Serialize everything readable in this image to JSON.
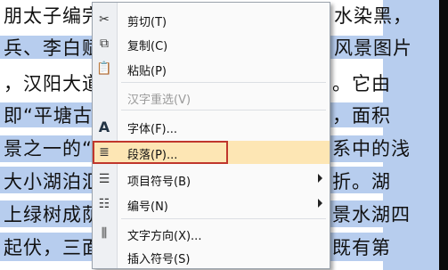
{
  "document": {
    "lines_left": [
      "朋太子编完",
      "兵、李白赋诗",
      "，汉阳大道以",
      "即“平塘古渡",
      "景之一的“平",
      "大小湖泊汇集",
      "上绿树成荫，",
      "起伏，三面环"
    ],
    "lines_right": [
      "水染黑，",
      "风景图片",
      "。它由",
      "，面积",
      "系中的浅",
      "折。湖",
      "景水湖四",
      "既有第"
    ]
  },
  "context_menu": {
    "items": [
      {
        "label": "剪切(T)",
        "icon": "scissors-icon",
        "glyph": "✂",
        "enabled": true
      },
      {
        "label": "复制(C)",
        "icon": "copy-icon",
        "glyph": "⧉",
        "enabled": true
      },
      {
        "label": "粘贴(P)",
        "icon": "paste-icon",
        "glyph": "📋",
        "enabled": true
      },
      {
        "label": "汉字重选(V)",
        "icon": "",
        "glyph": "",
        "enabled": false
      },
      {
        "label": "字体(F)...",
        "icon": "font-icon",
        "glyph": "A",
        "enabled": true
      },
      {
        "label": "段落(P)...",
        "icon": "paragraph-icon",
        "glyph": "≣",
        "enabled": true,
        "highlighted": true
      },
      {
        "label": "项目符号(B)",
        "icon": "bullets-icon",
        "glyph": "☰",
        "enabled": true,
        "submenu": true
      },
      {
        "label": "编号(N)",
        "icon": "numbering-icon",
        "glyph": "☷",
        "enabled": true,
        "submenu": true
      },
      {
        "label": "文字方向(X)...",
        "icon": "text-direction-icon",
        "glyph": "⫼",
        "enabled": true
      },
      {
        "label": "插入符号(S)",
        "icon": "",
        "glyph": "",
        "enabled": true
      }
    ]
  },
  "colors": {
    "selection": "#b7cdee",
    "highlight_border": "#c0362c",
    "hover": "#fde6b4"
  }
}
